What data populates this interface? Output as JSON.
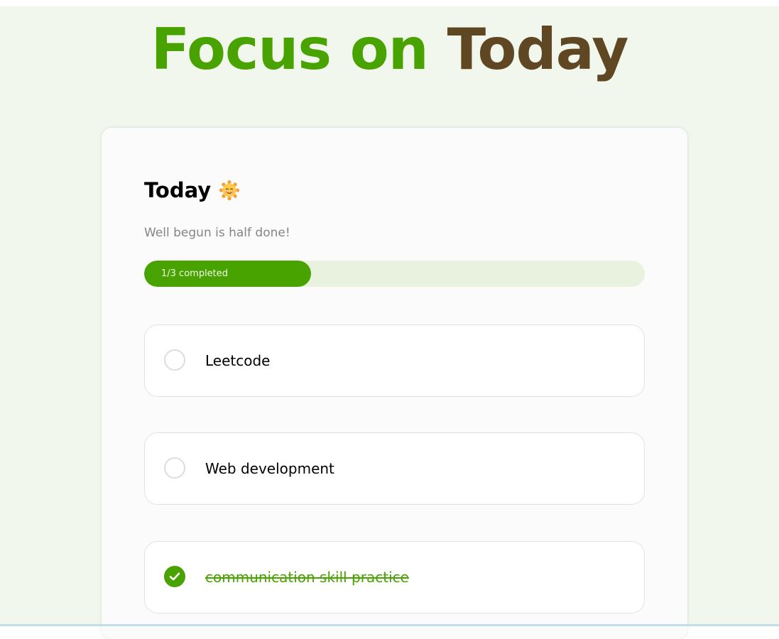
{
  "app": {
    "heading_part1": "Focus on",
    "heading_part2": "Today",
    "colors": {
      "accent": "#48A300",
      "heading_secondary": "#604724",
      "background": "#F1F7EC",
      "progress_track": "#E8F2DE"
    }
  },
  "card": {
    "title": "Today",
    "title_icon": "smiling-sun-icon",
    "quote": "Well begun is half done!",
    "progress": {
      "label": "1/3 completed",
      "completed": 1,
      "total": 3
    },
    "goals": [
      {
        "text": "Leetcode",
        "completed": false,
        "icon": "unchecked-circle-icon"
      },
      {
        "text": "Web development",
        "completed": false,
        "icon": "unchecked-circle-icon"
      },
      {
        "text": "communication skill practice",
        "completed": true,
        "icon": "check-icon"
      }
    ]
  }
}
